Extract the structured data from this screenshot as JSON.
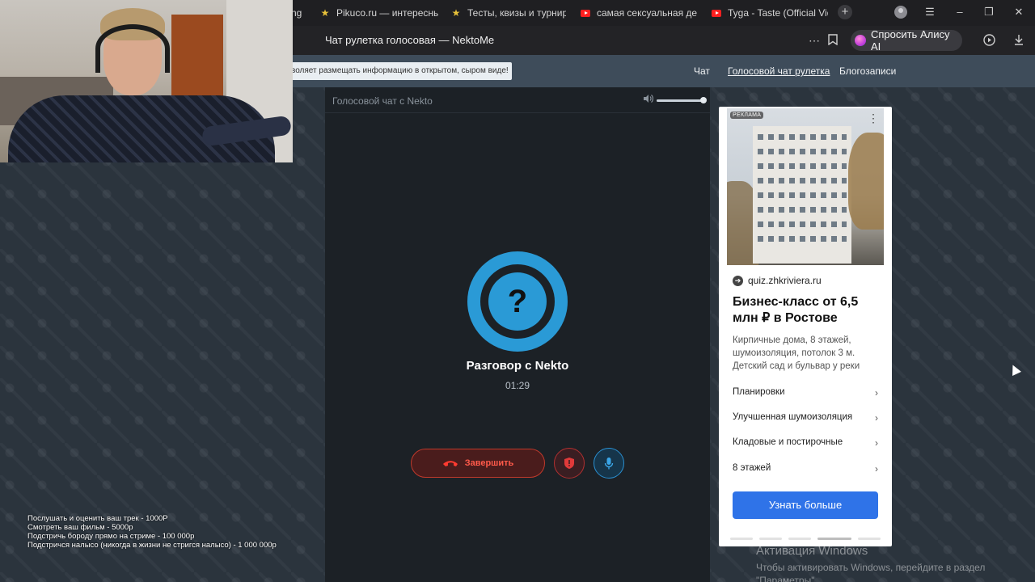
{
  "browser": {
    "tabs": [
      {
        "label": "ng",
        "icon": "none"
      },
      {
        "label": "Pikuco.ru — интересные",
        "icon": "star-icon"
      },
      {
        "label": "Тесты, квизы и турниры",
        "icon": "star-icon"
      },
      {
        "label": "самая сексуальная деву",
        "icon": "youtube-icon"
      },
      {
        "label": "Tyga - Taste (Official Vide",
        "icon": "youtube-icon"
      }
    ],
    "new_tab": "+",
    "page_title": "Чат рулетка голосовая — NektoMe",
    "alice_label": "Спросить Алису AI"
  },
  "site_nav": {
    "notice": "воляет размещать информацию в открытом, сыром виде!",
    "links": [
      {
        "label": "Чат",
        "active": false
      },
      {
        "label": "Голосовой чат рулетка",
        "active": true
      },
      {
        "label": "Блогозаписи",
        "active": false
      }
    ]
  },
  "voice_chat": {
    "header_title": "Голосовой чат с Nekto",
    "volume_level": 1.0,
    "avatar_symbol": "?",
    "conversation_title": "Разговор с Nekto",
    "timer": "01:29",
    "end_label": "Завершить",
    "accent_color": "#2a9ad6",
    "end_color": "#ff3b30"
  },
  "ad": {
    "label": "РЕКЛАМА",
    "domain": "quiz.zhkriviera.ru",
    "headline": "Бизнес-класс от 6,5 млн ₽ в Ростове",
    "description": "Кирпичные дома, 8 этажей, шумоизоляция, потолок 3 м. Детский сад и бульвар у реки",
    "items": [
      "Планировки",
      "Улучшенная шумоизоляция",
      "Кладовые и постирочные",
      "8 этажей"
    ],
    "cta": "Узнать больше",
    "cta_color": "#2f73e8"
  },
  "overlay_lines": [
    "Послушать и оценить ваш трек - 1000Р",
    "Смотреть ваш фильм - 5000р",
    "Подстричь бороду прямо на стриме - 100 000р",
    "Подстричся налысо (никогда в жизни не стригся налысо) - 1 000 000р"
  ],
  "windows": {
    "title": "Активация Windows",
    "subtitle": "Чтобы активировать Windows, перейдите в раздел \"Параметры\"."
  }
}
